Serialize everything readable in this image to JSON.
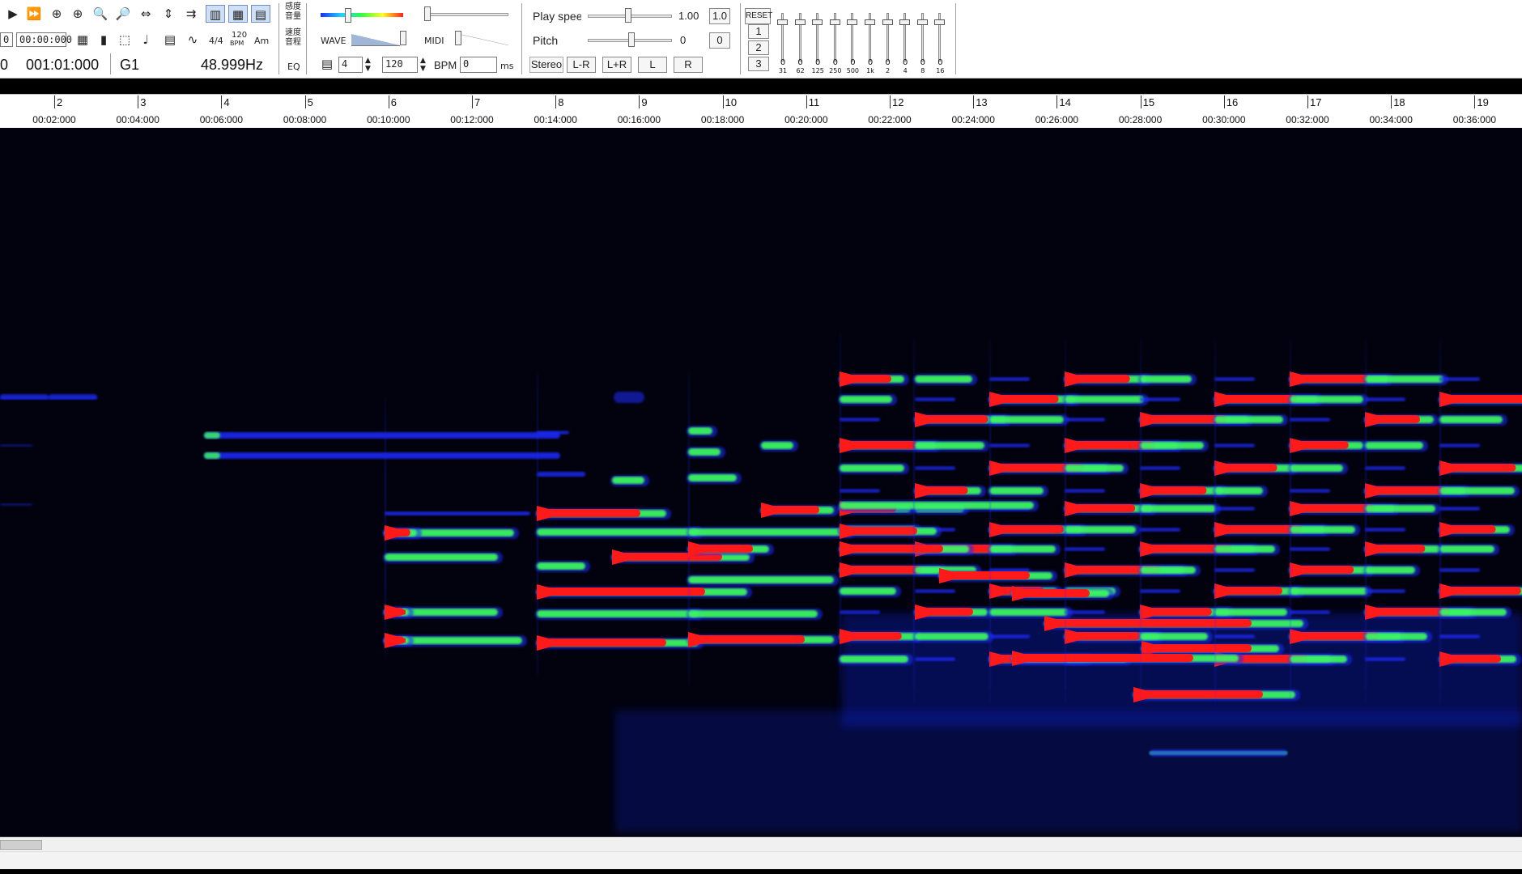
{
  "toolbar": {
    "transport_icons": [
      "play-icon",
      "fast-forward-icon",
      "zoom-fit-icon",
      "zoom-in-horizontal-icon",
      "zoom-in-icon",
      "zoom-out-icon",
      "fit-height-icon",
      "expand-icon",
      "loop-icon",
      "view-mode-1-icon",
      "view-mode-2-icon",
      "view-mode-3-icon"
    ],
    "time_field": "00:00:000",
    "time_sig": "4/4",
    "bpm_icon_top": "120",
    "bpm_icon_bottom": "BPM",
    "key_label": "Am",
    "position_left": "0",
    "position": "001:01:000",
    "note": "G1",
    "frequency": "48.999Hz",
    "eq_label": "EQ",
    "sens_label_top": "感度",
    "sens_label_bot": "音量",
    "speed_label_top": "速度",
    "speed_label_bot": "音程",
    "wave_label": "WAVE",
    "midi_label": "MIDI",
    "beats_value": "4",
    "bpm_value": "120",
    "bpm_label": "BPM",
    "ms_value": "0",
    "ms_label": "ms",
    "play_speed_label": "Play speed",
    "play_speed_value": "1.00",
    "play_speed_button": "1.0",
    "pitch_label": "Pitch",
    "pitch_value": "0",
    "pitch_button": "0",
    "stereo_label": "Stereo",
    "channel_buttons": [
      "L-R",
      "L+R",
      "L",
      "R"
    ],
    "reset_label": "RESET",
    "preset_buttons": [
      "1",
      "2",
      "3"
    ],
    "eq_bands": [
      {
        "gain": "0",
        "freq": "31"
      },
      {
        "gain": "0",
        "freq": "62"
      },
      {
        "gain": "0",
        "freq": "125"
      },
      {
        "gain": "0",
        "freq": "250"
      },
      {
        "gain": "0",
        "freq": "500"
      },
      {
        "gain": "0",
        "freq": "1k"
      },
      {
        "gain": "0",
        "freq": "2"
      },
      {
        "gain": "0",
        "freq": "4"
      },
      {
        "gain": "0",
        "freq": "8"
      },
      {
        "gain": "0",
        "freq": "16"
      }
    ]
  },
  "ruler": {
    "bars": [
      "2",
      "3",
      "4",
      "5",
      "6",
      "7",
      "8",
      "9",
      "10",
      "11",
      "12",
      "13",
      "14",
      "15",
      "16",
      "17",
      "18",
      "19"
    ],
    "times": [
      "00:02:000",
      "00:04:000",
      "00:06:000",
      "00:08:000",
      "00:10:000",
      "00:12:000",
      "00:14:000",
      "00:16:000",
      "00:18:000",
      "00:20:000",
      "00:22:000",
      "00:24:000",
      "00:26:000",
      "00:28:000",
      "00:30:000",
      "00:32:000",
      "00:34:000",
      "00:36:000"
    ]
  },
  "colors": {
    "background": "#02020f",
    "low": "#1a2cff",
    "mid": "#3cff5a",
    "high": "#ff1a1a"
  },
  "spectrogram": {
    "scroll_position": 0
  }
}
